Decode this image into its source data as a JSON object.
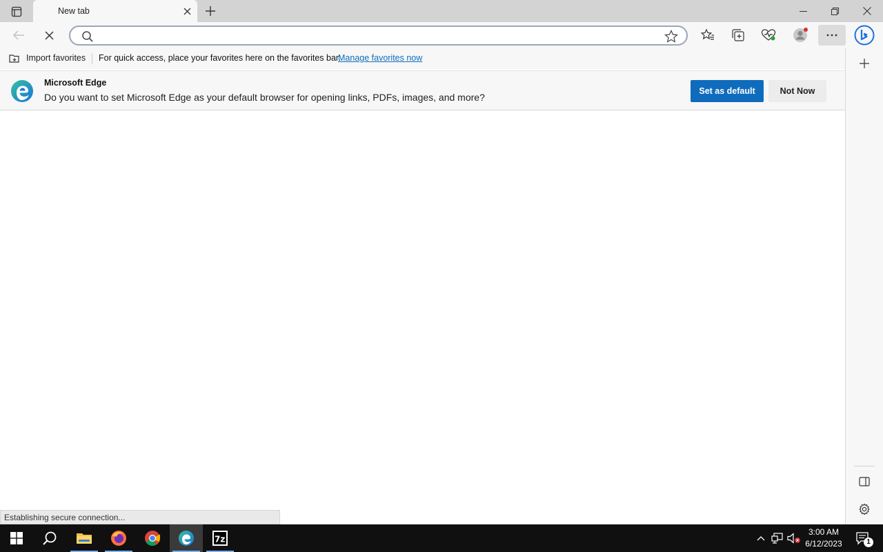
{
  "tab": {
    "title": "New tab"
  },
  "addressbar": {
    "value": "",
    "placeholder": ""
  },
  "favorites_bar": {
    "import_label": "Import favorites",
    "message": "For quick access, place your favorites here on the favorites bar.",
    "link": "Manage favorites now"
  },
  "infobar": {
    "title": "Microsoft Edge",
    "message": "Do you want to set Microsoft Edge as your default browser for opening links, PDFs, images, and more?",
    "primary_button": "Set as default",
    "secondary_button": "Not Now"
  },
  "status": {
    "text": "Establishing secure connection..."
  },
  "clock": {
    "time": "3:00 AM",
    "date": "6/12/2023"
  },
  "notifications": {
    "count": "1"
  },
  "colors": {
    "accent": "#0f6cbd",
    "taskbar": "#101010",
    "chrome": "#f7f7f7"
  }
}
